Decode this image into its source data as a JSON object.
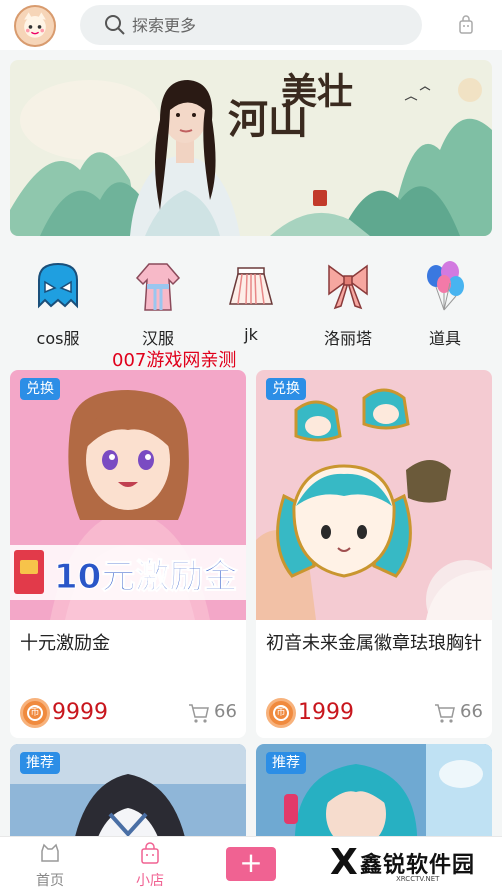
{
  "header": {
    "search_placeholder": "探索更多"
  },
  "banner": {
    "title_left": "山河",
    "title_right": "壮美",
    "seal": "中國"
  },
  "categories": [
    {
      "label": "cos服",
      "icon": "ghost-mask-icon"
    },
    {
      "label": "汉服",
      "icon": "hanfu-dress-icon"
    },
    {
      "label": "jk",
      "icon": "pleated-skirt-icon"
    },
    {
      "label": "洛丽塔",
      "icon": "bow-icon"
    },
    {
      "label": "道具",
      "icon": "balloons-icon"
    }
  ],
  "watermark": "007游戏网亲测",
  "products": [
    {
      "tag": "兑换",
      "name": "十元激励金",
      "price": "9999",
      "count": "66",
      "image_text": "10元激励金"
    },
    {
      "tag": "兑换",
      "name": "初音未来金属徽章珐琅胸针",
      "price": "1999",
      "count": "66"
    },
    {
      "tag": "推荐"
    },
    {
      "tag": "推荐"
    }
  ],
  "coin_glyph": "币",
  "tabbar": {
    "home": "首页",
    "shop": "小店",
    "plus": "+",
    "brand_name": "鑫锐软件园",
    "brand_url": "XRCCTV.NET",
    "brand_mark": "X"
  },
  "colors": {
    "accent_pink": "#f06292",
    "tag_blue": "#2c8ee6",
    "price_red": "#c8161d",
    "coin_orange": "#f08a3e"
  }
}
